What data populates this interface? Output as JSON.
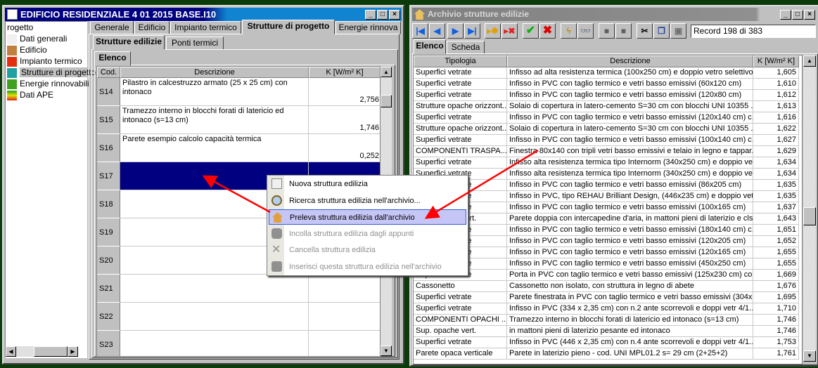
{
  "left_window": {
    "title": "EDIFICIO RESIDENZIALE 4 01 2015 BASE.I10",
    "tree": {
      "root": "rogetto",
      "items": [
        {
          "label": "Dati generali",
          "icon": "document-icon"
        },
        {
          "label": "Edificio",
          "icon": "house-icon"
        },
        {
          "label": "Impianto termico",
          "icon": "flame-icon"
        },
        {
          "label": "Strutture di progetto",
          "icon": "structure-icon",
          "selected": true
        },
        {
          "label": "Energie rinnovabili",
          "icon": "tree-icon"
        },
        {
          "label": "Dati APE",
          "icon": "energy-class-icon"
        }
      ]
    },
    "tabs": [
      "Generale",
      "Edificio",
      "Impianto termico",
      "Strutture di progetto",
      "Energie rinnova"
    ],
    "active_tab": "Strutture di progetto",
    "subtabs": [
      "Strutture edilizie",
      "Ponti termici"
    ],
    "inner_tab": "Elenco",
    "columns": [
      "Cod.",
      "Descrizione",
      "K [W/m² K]"
    ],
    "rows": [
      {
        "cod": "S14",
        "desc": "Pilastro in calcestruzzo armato (25 x 25 cm) con intonaco",
        "k": "2,756"
      },
      {
        "cod": "S15",
        "desc": "Tramezzo interno in blocchi forati di latericio ed intonaco (s=13 cm)",
        "k": "1,746"
      },
      {
        "cod": "S16",
        "desc": "Parete esempio calcolo capacità termica",
        "k": "0,252"
      },
      {
        "cod": "S17",
        "desc": "",
        "k": "",
        "selected": true
      },
      {
        "cod": "S18",
        "desc": "",
        "k": ""
      },
      {
        "cod": "S19",
        "desc": "",
        "k": ""
      },
      {
        "cod": "S20",
        "desc": "",
        "k": ""
      },
      {
        "cod": "S21",
        "desc": "",
        "k": ""
      },
      {
        "cod": "S22",
        "desc": "",
        "k": ""
      },
      {
        "cod": "S23",
        "desc": "",
        "k": ""
      }
    ]
  },
  "context_menu": [
    {
      "label": "Nuova struttura edilizia",
      "icon": "new-structure-icon",
      "enabled": true
    },
    {
      "label": "Ricerca struttura edilizia nell'archivio...",
      "icon": "magnifier-icon",
      "enabled": true
    },
    {
      "label": "Preleva struttura edilizia dall'archivio",
      "icon": "house-icon",
      "enabled": true,
      "highlighted": true
    },
    {
      "label": "Incolla struttura edilizia dagli appunti",
      "icon": "paste-icon",
      "enabled": false
    },
    {
      "label": "Cancella struttura edilizia",
      "icon": "x-icon",
      "enabled": false
    },
    {
      "label": "Inserisci questa struttura edilizia nell'archivio",
      "icon": "database-icon",
      "enabled": false
    }
  ],
  "right_window": {
    "title": "Archivio strutture edilizie",
    "record": "Record 198 di 383",
    "tabs": [
      "Elenco",
      "Scheda"
    ],
    "active_tab": "Elenco",
    "columns": [
      "Tipologia",
      "Descrizione",
      "K [W/m² K]"
    ],
    "rows": [
      [
        "Superfici vetrate",
        "Infisso ad alta resistenza termica (100x250 cm) e doppio vetro selettivo...",
        "1,605"
      ],
      [
        "Superfici vetrate",
        "Infisso in PVC con taglio termico e vetri basso emissivi (60x120 cm)",
        "1,610"
      ],
      [
        "Superfici vetrate",
        "Infisso in PVC con taglio termico e vetri basso emissivi (120x80 cm)",
        "1,612"
      ],
      [
        "Strutture opache orizzont...",
        "Solaio di copertura in latero-cemento S=30 cm con blocchi UNI 10355 ...",
        "1,613"
      ],
      [
        "Superfici vetrate",
        "Infisso in PVC con taglio termico e vetri basso emissivi (120x140 cm) c...",
        "1,616"
      ],
      [
        "Strutture opache orizzont...",
        "Solaio di copertura in latero-cemento S=30 cm con blocchi UNI 10355 ...",
        "1,622"
      ],
      [
        "Superfici vetrate",
        "Infisso in PVC con taglio termico e vetri basso emissivi (100x140 cm) c...",
        "1,627"
      ],
      [
        "COMPONENTI TRASPA...",
        "Finestra 80x140 con tripli vetri basso emissivi e telaio in legno e tappar...",
        "1,629"
      ],
      [
        "Superfici vetrate",
        "Infisso alta resistenza termica tipo Internorm (340x250 cm) e doppio vet...",
        "1,634"
      ],
      [
        "Superfici vetrate",
        "Infisso alta resistenza termica tipo Internorm (340x250 cm) e doppio vet...",
        "1,634"
      ],
      [
        "Superfici vetrate",
        "Infisso in PVC con taglio termico e vetri basso emissivi (86x205 cm)",
        "1,635"
      ],
      [
        "Superfici vetrate",
        "Infisso in PVC, tipo REHAU Brilliant Design, (446x235 cm) e doppio vet...",
        "1,635"
      ],
      [
        "Superfici vetrate",
        "Infisso in PVC con taglio termico e vetri basso emissivi (100x165 cm)",
        "1,637"
      ],
      [
        "Sup. opache vert.",
        "Parete doppia con intercapedine d'aria, in mattoni pieni di laterizio e cls",
        "1,643"
      ],
      [
        "Superfici vetrate",
        "Infisso in PVC con taglio termico e vetri basso emissivi (180x140 cm) c...",
        "1,651"
      ],
      [
        "Superfici vetrate",
        "Infisso in PVC con taglio termico e vetri basso emissivi (120x205 cm)",
        "1,652"
      ],
      [
        "Superfici vetrate",
        "Infisso in PVC con taglio termico e vetri basso emissivi (120x165 cm)",
        "1,655"
      ],
      [
        "Superfici vetrate",
        "Infisso in PVC con taglio termico e vetri basso emissivi (450x250 cm)",
        "1,655"
      ],
      [
        "Superfici vetrate",
        "Porta in PVC con taglio termico e vetri basso emissivi (125x230 cm) co...",
        "1,669"
      ],
      [
        "Cassonetto",
        "Cassonetto non isolato, con struttura in legno di abete",
        "1,676"
      ],
      [
        "Superfici vetrate",
        "Parete finestrata in PVC con taglio termico e vetri basso emissivi (304x...",
        "1,695"
      ],
      [
        "Superfici vetrate",
        "Infisso in PVC (334 x 2,35 cm) con n.2 ante scorrevoli e doppi vetr 4/1...",
        "1,710"
      ],
      [
        "COMPONENTI OPACHI ...",
        "Tramezzo interno in blocchi forati di latericio ed intonaco (s=13 cm)",
        "1,746"
      ],
      [
        "Sup. opache vert.",
        "in mattoni pieni di laterizio pesante ed intonaco",
        "1,746"
      ],
      [
        "Superfici vetrate",
        "Infisso in PVC (446 x 2,35 cm) con n.4 ante scorrevoli e doppi vetr 4/1...",
        "1,753"
      ],
      [
        "Parete opaca verticale",
        "Parete in laterizio pieno - cod. UNI MPL01.2 s= 29 cm (2+25+2)",
        "1,761"
      ]
    ]
  },
  "colors": {
    "selection": "#000080",
    "highlight": "#c6c6f6",
    "arrow": "#ff0000",
    "desktop": "#0b3a0b"
  }
}
